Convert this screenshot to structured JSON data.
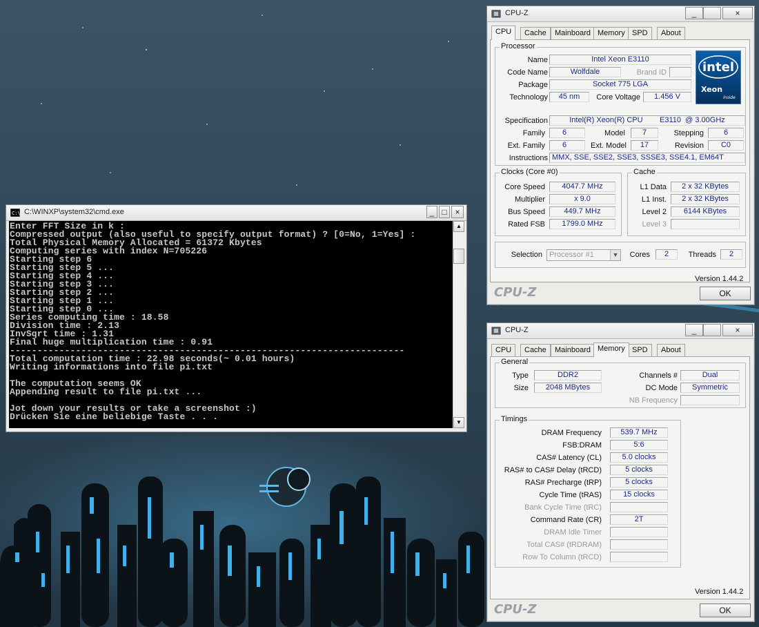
{
  "cmd": {
    "title": "C:\\WINXP\\system32\\cmd.exe",
    "lines": [
      "Enter FFT Size in k :",
      "Compressed output (also useful to specify output format) ? [0=No, 1=Yes] :",
      "Total Physical Memory Allocated = 61372 Kbytes",
      "Computing series with index N=705226",
      "Starting step 6",
      "Starting step 5 ...",
      "Starting step 4 ...",
      "Starting step 3 ...",
      "Starting step 2 ...",
      "Starting step 1 ...",
      "Starting step 0 ...",
      "Series computing time : 18.58",
      "Division time : 2.13",
      "InvSqrt time : 1.31",
      "Final huge multiplication time : 0.91",
      "------------------------------------------------------------------------",
      "Total computation time : 22.98 seconds(~ 0.01 hours)",
      "Writing informations into file pi.txt",
      "",
      "The computation seems OK",
      "Appending result to file pi.txt ...",
      "",
      "Jot down your results or take a screenshot :)",
      "Drücken Sie eine beliebige Taste . . ."
    ],
    "buttons": {
      "minimize": "_",
      "maximize": "□",
      "close": "×"
    }
  },
  "cpuz_cpu": {
    "title": "CPU-Z",
    "tabs": [
      "CPU",
      "Cache",
      "Mainboard",
      "Memory",
      "SPD",
      "About"
    ],
    "active_tab": "CPU",
    "processor": {
      "group_label": "Processor",
      "name_label": "Name",
      "name": "Intel Xeon E3110",
      "codename_label": "Code Name",
      "codename": "Wolfdale",
      "brandid_label": "Brand ID",
      "brandid": "",
      "package_label": "Package",
      "package": "Socket 775 LGA",
      "technology_label": "Technology",
      "technology": "45 nm",
      "corevoltage_label": "Core Voltage",
      "corevoltage": "1.456 V",
      "specification_label": "Specification",
      "specification": "Intel(R) Xeon(R) CPU        E3110  @ 3.00GHz",
      "family_label": "Family",
      "family": "6",
      "model_label": "Model",
      "model": "7",
      "stepping_label": "Stepping",
      "stepping": "6",
      "extfamily_label": "Ext. Family",
      "extfamily": "6",
      "extmodel_label": "Ext. Model",
      "extmodel": "17",
      "revision_label": "Revision",
      "revision": "C0",
      "instructions_label": "Instructions",
      "instructions": "MMX, SSE, SSE2, SSE3, SSSE3, SSE4.1, EM64T",
      "logo_brand": "intel",
      "logo_product": "Xeon",
      "logo_inside": "inside"
    },
    "clocks": {
      "group_label": "Clocks (Core #0)",
      "corespeed_label": "Core Speed",
      "corespeed": "4047.7 MHz",
      "multiplier_label": "Multiplier",
      "multiplier": "x 9.0",
      "busspeed_label": "Bus Speed",
      "busspeed": "449.7 MHz",
      "ratedfsb_label": "Rated FSB",
      "ratedfsb": "1799.0 MHz"
    },
    "cache": {
      "group_label": "Cache",
      "l1data_label": "L1 Data",
      "l1data": "2 x 32 KBytes",
      "l1inst_label": "L1 Inst.",
      "l1inst": "2 x 32 KBytes",
      "level2_label": "Level 2",
      "level2": "6144 KBytes",
      "level3_label": "Level 3",
      "level3": ""
    },
    "selection": {
      "selection_label": "Selection",
      "selection": "Processor #1",
      "cores_label": "Cores",
      "cores": "2",
      "threads_label": "Threads",
      "threads": "2"
    },
    "version": "Version 1.44.2",
    "logo": "CPU-Z",
    "ok": "OK"
  },
  "cpuz_mem": {
    "title": "CPU-Z",
    "tabs": [
      "CPU",
      "Cache",
      "Mainboard",
      "Memory",
      "SPD",
      "About"
    ],
    "active_tab": "Memory",
    "general": {
      "group_label": "General",
      "type_label": "Type",
      "type": "DDR2",
      "size_label": "Size",
      "size": "2048 MBytes",
      "channels_label": "Channels #",
      "channels": "Dual",
      "dcmode_label": "DC Mode",
      "dcmode": "Symmetric",
      "nbfreq_label": "NB Frequency",
      "nbfreq": ""
    },
    "timings": {
      "group_label": "Timings",
      "rows": [
        {
          "label": "DRAM Frequency",
          "value": "539.7 MHz",
          "dim": false
        },
        {
          "label": "FSB:DRAM",
          "value": "5:6",
          "dim": false
        },
        {
          "label": "CAS# Latency (CL)",
          "value": "5.0 clocks",
          "dim": false
        },
        {
          "label": "RAS# to CAS# Delay (tRCD)",
          "value": "5 clocks",
          "dim": false
        },
        {
          "label": "RAS# Precharge (tRP)",
          "value": "5 clocks",
          "dim": false
        },
        {
          "label": "Cycle Time (tRAS)",
          "value": "15 clocks",
          "dim": false
        },
        {
          "label": "Bank Cycle Time (tRC)",
          "value": "",
          "dim": true
        },
        {
          "label": "Command Rate (CR)",
          "value": "2T",
          "dim": false
        },
        {
          "label": "DRAM Idle Timer",
          "value": "",
          "dim": true
        },
        {
          "label": "Total CAS# (tRDRAM)",
          "value": "",
          "dim": true
        },
        {
          "label": "Row To Column (tRCD)",
          "value": "",
          "dim": true
        }
      ]
    },
    "version": "Version 1.44.2",
    "logo": "CPU-Z",
    "ok": "OK"
  },
  "colors": {
    "value_text": "#1a2a8a",
    "console_bg": "#000000",
    "console_text": "#c8c8c8",
    "intel_blue": "#0a5ea8"
  }
}
